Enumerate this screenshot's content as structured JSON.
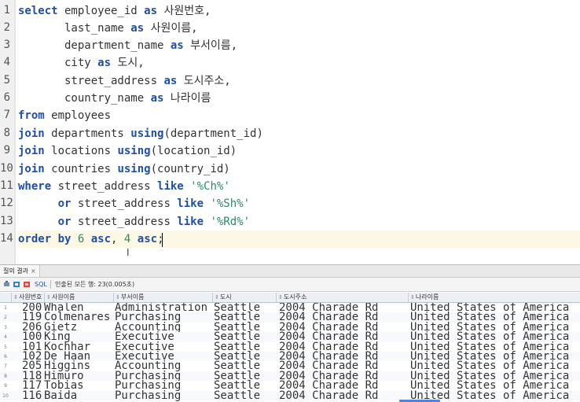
{
  "editor": {
    "line_numbers": [
      "1",
      "2",
      "3",
      "4",
      "5",
      "6",
      "7",
      "8",
      "9",
      "10",
      "11",
      "12",
      "13",
      "14"
    ],
    "lines": [
      {
        "tokens": [
          {
            "t": "kw",
            "v": "select"
          },
          {
            "t": "p",
            "v": " employee_id "
          },
          {
            "t": "kw",
            "v": "as"
          },
          {
            "t": "p",
            "v": " "
          },
          {
            "t": "ko",
            "v": "사원번호"
          },
          {
            "t": "p",
            "v": ","
          }
        ]
      },
      {
        "tokens": [
          {
            "t": "p",
            "v": "       last_name "
          },
          {
            "t": "kw",
            "v": "as"
          },
          {
            "t": "p",
            "v": " "
          },
          {
            "t": "ko",
            "v": "사원이름"
          },
          {
            "t": "p",
            "v": ","
          }
        ]
      },
      {
        "tokens": [
          {
            "t": "p",
            "v": "       department_name "
          },
          {
            "t": "kw",
            "v": "as"
          },
          {
            "t": "p",
            "v": " "
          },
          {
            "t": "ko",
            "v": "부서이름"
          },
          {
            "t": "p",
            "v": ","
          }
        ]
      },
      {
        "tokens": [
          {
            "t": "p",
            "v": "       city "
          },
          {
            "t": "kw",
            "v": "as"
          },
          {
            "t": "p",
            "v": " "
          },
          {
            "t": "ko",
            "v": "도시"
          },
          {
            "t": "p",
            "v": ","
          }
        ]
      },
      {
        "tokens": [
          {
            "t": "p",
            "v": "       street_address "
          },
          {
            "t": "kw",
            "v": "as"
          },
          {
            "t": "p",
            "v": " "
          },
          {
            "t": "ko",
            "v": "도시주소"
          },
          {
            "t": "p",
            "v": ","
          }
        ]
      },
      {
        "tokens": [
          {
            "t": "p",
            "v": "       country_name "
          },
          {
            "t": "kw",
            "v": "as"
          },
          {
            "t": "p",
            "v": " "
          },
          {
            "t": "ko",
            "v": "나라이름"
          }
        ]
      },
      {
        "tokens": [
          {
            "t": "kw",
            "v": "from"
          },
          {
            "t": "p",
            "v": " employees"
          }
        ]
      },
      {
        "tokens": [
          {
            "t": "kw",
            "v": "join"
          },
          {
            "t": "p",
            "v": " departments "
          },
          {
            "t": "kw",
            "v": "using"
          },
          {
            "t": "p",
            "v": "(department_id)"
          }
        ]
      },
      {
        "tokens": [
          {
            "t": "kw",
            "v": "join"
          },
          {
            "t": "p",
            "v": " locations "
          },
          {
            "t": "kw",
            "v": "using"
          },
          {
            "t": "p",
            "v": "(location_id)"
          }
        ]
      },
      {
        "tokens": [
          {
            "t": "kw",
            "v": "join"
          },
          {
            "t": "p",
            "v": " countries "
          },
          {
            "t": "kw",
            "v": "using"
          },
          {
            "t": "p",
            "v": "(country_id)"
          }
        ]
      },
      {
        "tokens": [
          {
            "t": "kw",
            "v": "where"
          },
          {
            "t": "p",
            "v": " street_address "
          },
          {
            "t": "kw",
            "v": "like"
          },
          {
            "t": "p",
            "v": " "
          },
          {
            "t": "str",
            "v": "'%Ch%'"
          }
        ]
      },
      {
        "tokens": [
          {
            "t": "p",
            "v": "      "
          },
          {
            "t": "kw",
            "v": "or"
          },
          {
            "t": "p",
            "v": " street_address "
          },
          {
            "t": "kw",
            "v": "like"
          },
          {
            "t": "p",
            "v": " "
          },
          {
            "t": "str",
            "v": "'%Sh%'"
          }
        ]
      },
      {
        "tokens": [
          {
            "t": "p",
            "v": "      "
          },
          {
            "t": "kw",
            "v": "or"
          },
          {
            "t": "p",
            "v": " street_address "
          },
          {
            "t": "kw",
            "v": "like"
          },
          {
            "t": "p",
            "v": " "
          },
          {
            "t": "str",
            "v": "'%Rd%'"
          }
        ]
      },
      {
        "tokens": [
          {
            "t": "kw",
            "v": "order by"
          },
          {
            "t": "p",
            "v": " "
          },
          {
            "t": "num",
            "v": "6"
          },
          {
            "t": "p",
            "v": " "
          },
          {
            "t": "kw",
            "v": "asc"
          },
          {
            "t": "p",
            "v": ", "
          },
          {
            "t": "num",
            "v": "4"
          },
          {
            "t": "p",
            "v": " "
          },
          {
            "t": "kw",
            "v": "asc"
          },
          {
            "t": "p",
            "v": ";"
          }
        ]
      }
    ],
    "current_line": 14,
    "ibeam_glyph": "I"
  },
  "results": {
    "tab_label": "질의 결과",
    "tab_close": "×",
    "toolbar_sql": "SQL",
    "status_text": "인출된 모든 행: 23(0.005초)",
    "columns": [
      "사원번호",
      "사원이름",
      "부서이름",
      "도시",
      "도시주소",
      "나라이름"
    ],
    "rows": [
      [
        "1",
        "200",
        "Whalen",
        "Administration",
        "Seattle",
        "2004 Charade Rd",
        "United States of America"
      ],
      [
        "2",
        "119",
        "Colmenares",
        "Purchasing",
        "Seattle",
        "2004 Charade Rd",
        "United States of America"
      ],
      [
        "3",
        "206",
        "Gietz",
        "Accounting",
        "Seattle",
        "2004 Charade Rd",
        "United States of America"
      ],
      [
        "4",
        "100",
        "King",
        "Executive",
        "Seattle",
        "2004 Charade Rd",
        "United States of America"
      ],
      [
        "5",
        "101",
        "Kochhar",
        "Executive",
        "Seattle",
        "2004 Charade Rd",
        "United States of America"
      ],
      [
        "6",
        "102",
        "De Haan",
        "Executive",
        "Seattle",
        "2004 Charade Rd",
        "United States of America"
      ],
      [
        "7",
        "205",
        "Higgins",
        "Accounting",
        "Seattle",
        "2004 Charade Rd",
        "United States of America"
      ],
      [
        "8",
        "118",
        "Himuro",
        "Purchasing",
        "Seattle",
        "2004 Charade Rd",
        "United States of America"
      ],
      [
        "9",
        "117",
        "Tobias",
        "Purchasing",
        "Seattle",
        "2004 Charade Rd",
        "United States of America"
      ],
      [
        "10",
        "116",
        "Baida",
        "Purchasing",
        "Seattle",
        "2004 Charade Rd",
        "United States of America"
      ]
    ]
  },
  "icons": {
    "toolbar": [
      "pin-icon",
      "export-icon",
      "refresh-icon"
    ]
  },
  "colors": {
    "keyword": "#1f4fa8",
    "string": "#2a8a6a",
    "current_line_bg": "#fdf8e3"
  }
}
